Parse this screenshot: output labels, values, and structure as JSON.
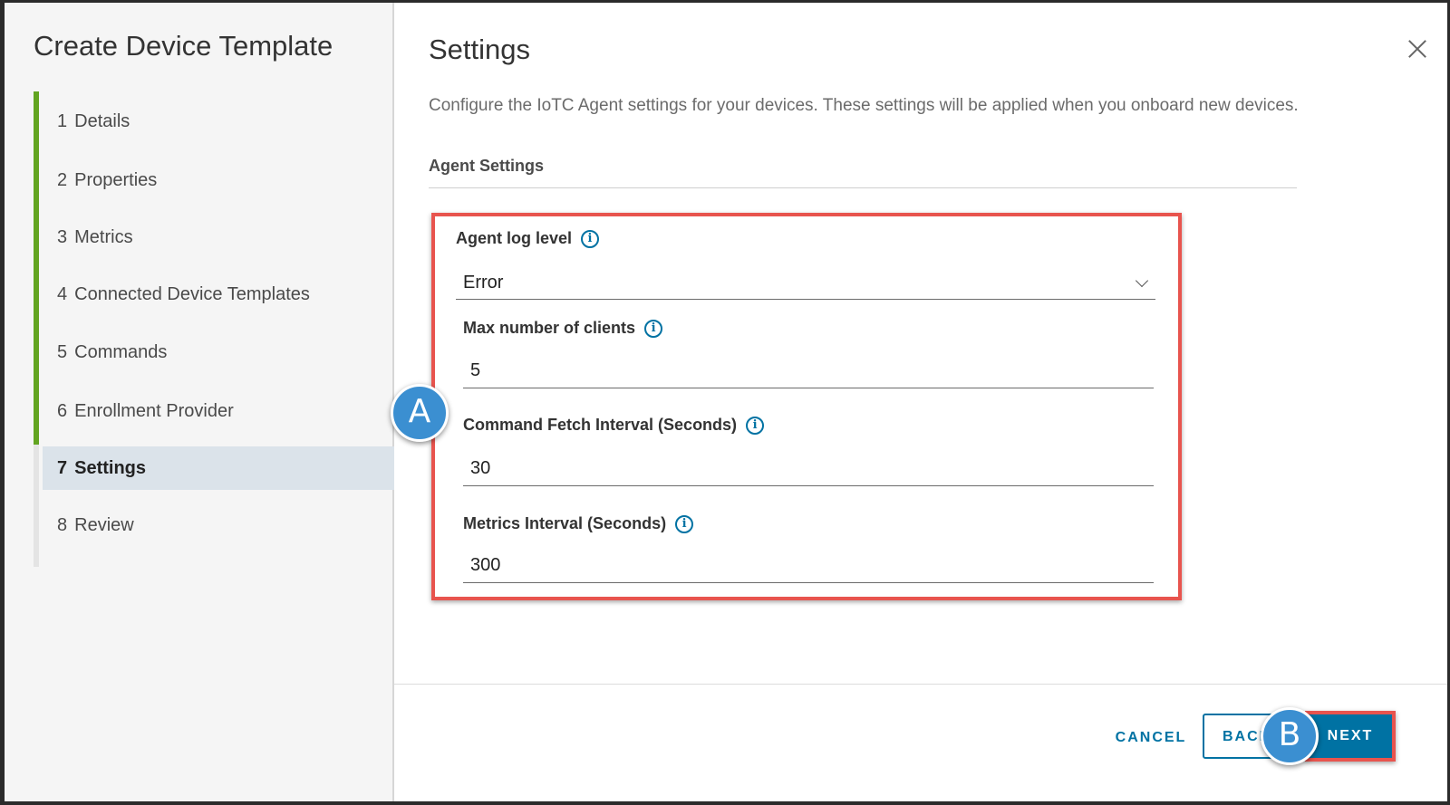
{
  "wizard": {
    "title": "Create Device Template",
    "steps": [
      {
        "num": "1",
        "label": "Details"
      },
      {
        "num": "2",
        "label": "Properties"
      },
      {
        "num": "3",
        "label": "Metrics"
      },
      {
        "num": "4",
        "label": "Connected Device Templates"
      },
      {
        "num": "5",
        "label": "Commands"
      },
      {
        "num": "6",
        "label": "Enrollment Provider"
      },
      {
        "num": "7",
        "label": "Settings"
      },
      {
        "num": "8",
        "label": "Review"
      }
    ],
    "active_step": 7,
    "completed_color": "#62a420"
  },
  "page": {
    "title": "Settings",
    "description": "Configure the IoTC Agent settings for your devices. These settings will be applied when you onboard new devices.",
    "section": "Agent Settings",
    "close_icon": "close-icon"
  },
  "fields": {
    "log_level": {
      "label": "Agent log level",
      "value": "Error"
    },
    "max_clients": {
      "label": "Max number of clients",
      "value": "5"
    },
    "fetch_interval": {
      "label": "Command Fetch Interval (Seconds)",
      "value": "30"
    },
    "metrics_interval": {
      "label": "Metrics Interval (Seconds)",
      "value": "300"
    }
  },
  "annotations": {
    "a": "A",
    "b": "B",
    "highlight_color": "#e8544e",
    "badge_color": "#3b8fd1"
  },
  "footer": {
    "cancel": "CANCEL",
    "back": "BACK",
    "next": "NEXT"
  },
  "colors": {
    "primary": "#0072a3"
  }
}
